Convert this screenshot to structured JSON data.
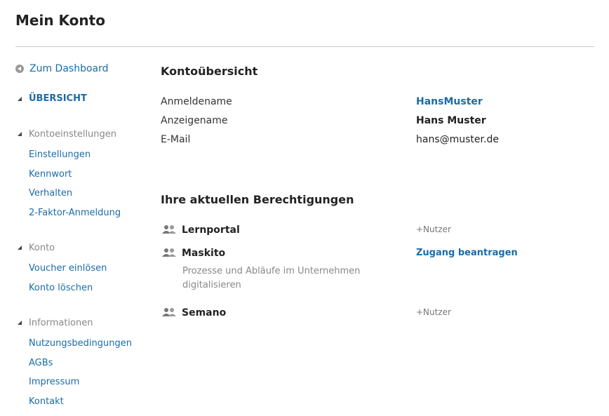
{
  "header": {
    "title": "Mein Konto"
  },
  "sidebar": {
    "back_label": "Zum Dashboard",
    "overview": "ÜBERSICHT",
    "sections": [
      {
        "title": "Kontoeinstellungen",
        "items": [
          "Einstellungen",
          "Kennwort",
          "Verhalten",
          "2-Faktor-Anmeldung"
        ]
      },
      {
        "title": "Konto",
        "items": [
          "Voucher einlösen",
          "Konto löschen"
        ]
      },
      {
        "title": "Informationen",
        "items": [
          "Nutzungsbedingungen",
          "AGBs",
          "Impressum",
          "Kontakt"
        ]
      }
    ]
  },
  "overview": {
    "title": "Kontoübersicht",
    "rows": [
      {
        "label": "Anmeldename",
        "value": "HansMuster"
      },
      {
        "label": "Anzeigename",
        "value": "Hans Muster"
      },
      {
        "label": "E-Mail",
        "value": "hans@muster.de"
      }
    ]
  },
  "permissions": {
    "title": "Ihre aktuellen Berechtigungen",
    "items": [
      {
        "name": "Lernportal",
        "action": "+Nutzer"
      },
      {
        "name": "Maskito",
        "action": "Zugang beantragen",
        "description": "Prozesse und Abläufe im Unternehmen digitalisieren"
      },
      {
        "name": "Semano",
        "action": "+Nutzer"
      }
    ]
  },
  "colors": {
    "link": "#1a6ca8",
    "muted": "#888888",
    "text": "#333333"
  }
}
